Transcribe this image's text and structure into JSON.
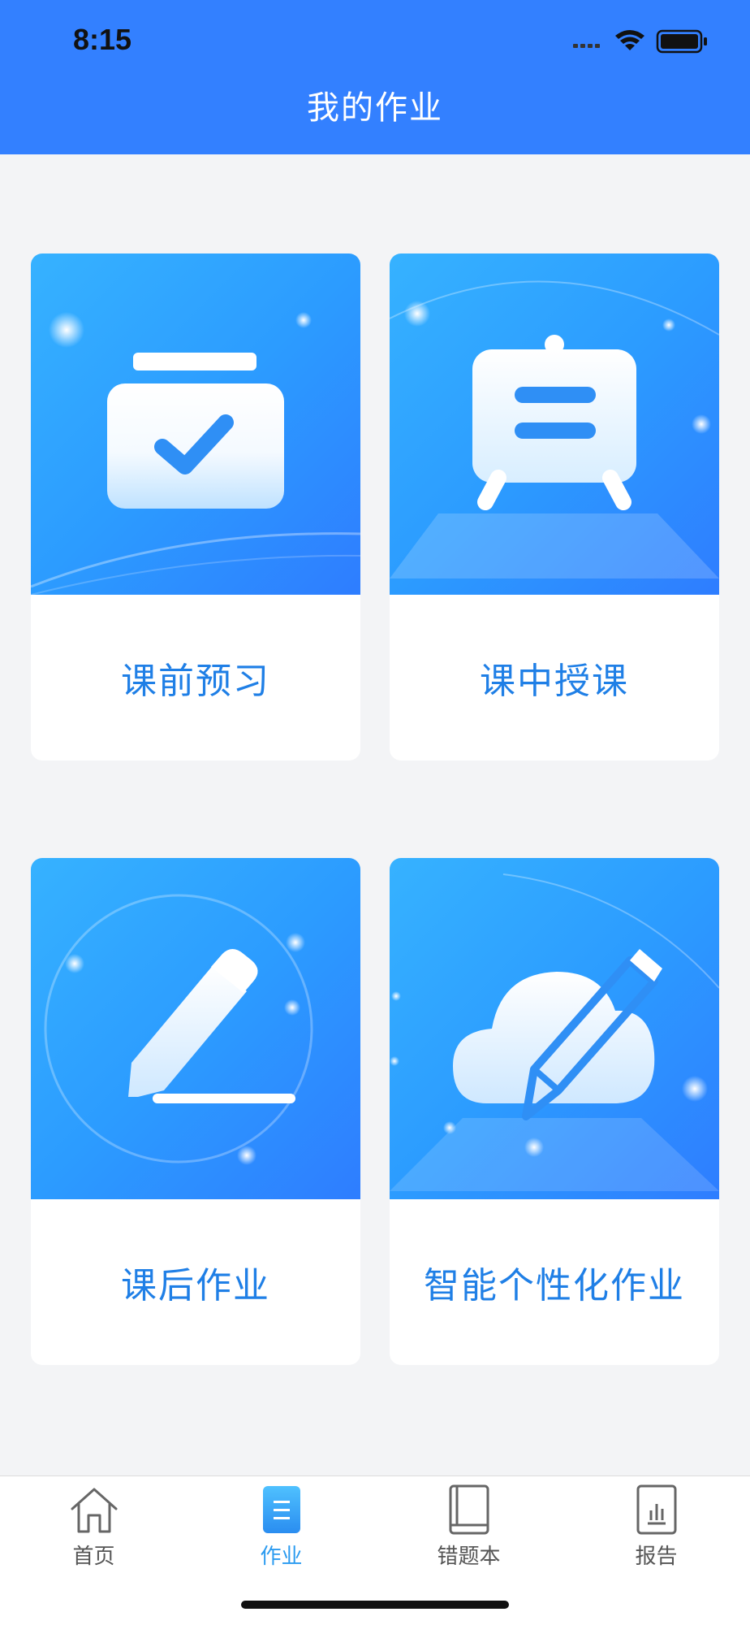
{
  "status_bar": {
    "time": "8:15"
  },
  "header": {
    "title": "我的作业"
  },
  "cards": [
    {
      "label": "课前预习",
      "icon": "clipboard-check-icon"
    },
    {
      "label": "课中授课",
      "icon": "easel-icon"
    },
    {
      "label": "课后作业",
      "icon": "pencil-icon"
    },
    {
      "label": "智能个性化作业",
      "icon": "cloud-pencil-icon"
    }
  ],
  "tabbar": {
    "items": [
      {
        "label": "首页",
        "icon": "home-icon",
        "active": false
      },
      {
        "label": "作业",
        "icon": "homework-icon",
        "active": true
      },
      {
        "label": "错题本",
        "icon": "book-icon",
        "active": false
      },
      {
        "label": "报告",
        "icon": "report-chart-icon",
        "active": false
      }
    ]
  },
  "colors": {
    "header": "#3380ff",
    "card_label": "#1f7fe6",
    "tab_active": "#2b9bf0",
    "tab_inactive": "#555555"
  }
}
